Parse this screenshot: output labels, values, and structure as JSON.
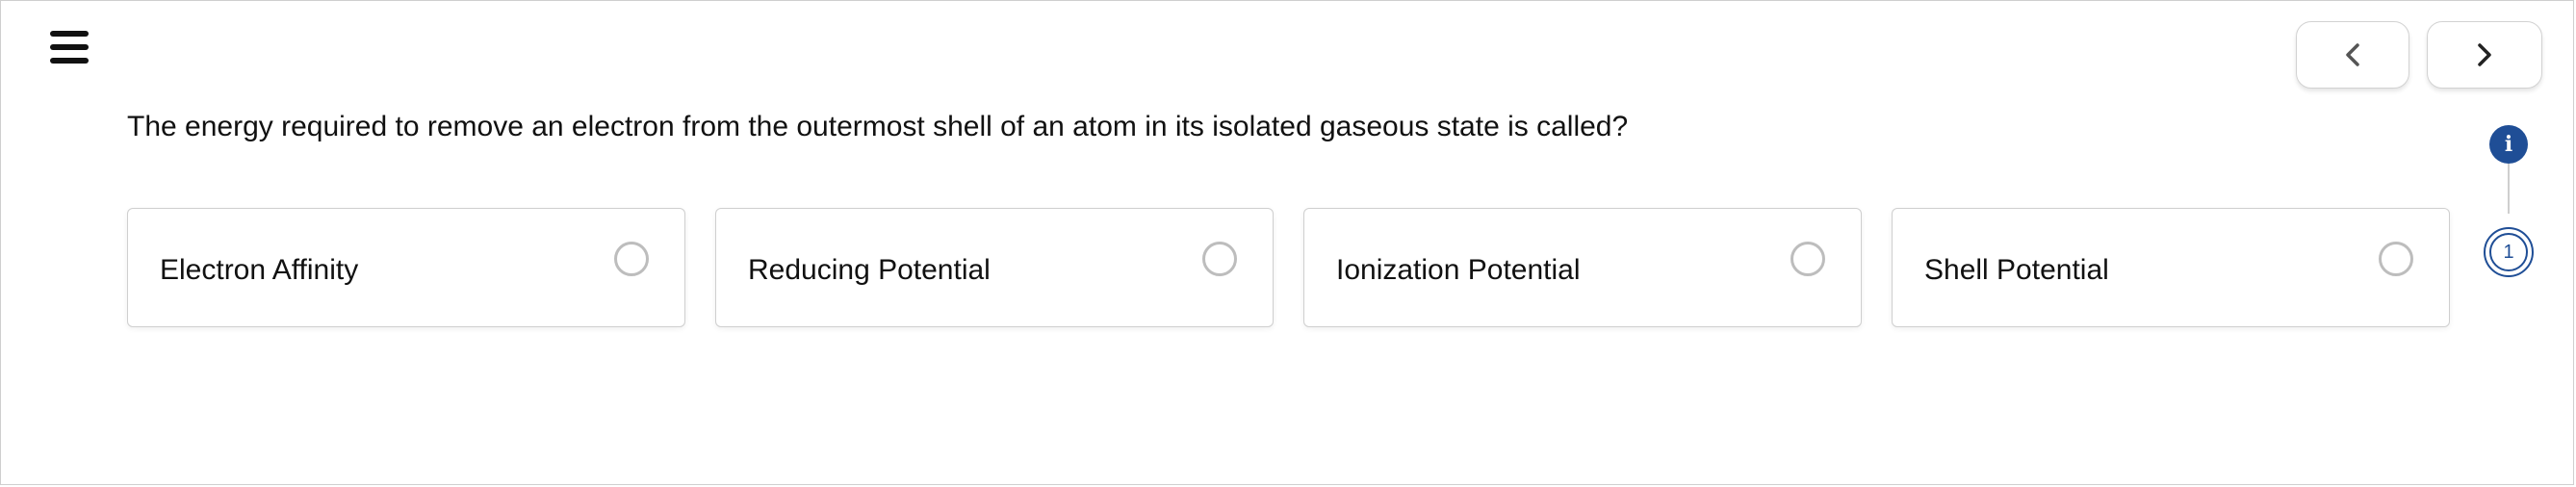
{
  "header": {
    "menu_icon": "hamburger-menu-icon",
    "prev_icon": "chevron-left-icon",
    "next_icon": "chevron-right-icon"
  },
  "question": {
    "text": "The energy required to remove an electron from the outermost shell of an atom in its isolated gaseous state is called?"
  },
  "options": [
    {
      "label": "Electron Affinity",
      "selected": false
    },
    {
      "label": "Reducing Potential",
      "selected": false
    },
    {
      "label": "Ionization Potential",
      "selected": false
    },
    {
      "label": "Shell Potential",
      "selected": false
    }
  ],
  "progress": {
    "info_label": "i",
    "current_step": "1"
  },
  "colors": {
    "accent": "#1f4e96",
    "border": "#cfcfcf",
    "radio": "#bdbdbd"
  }
}
